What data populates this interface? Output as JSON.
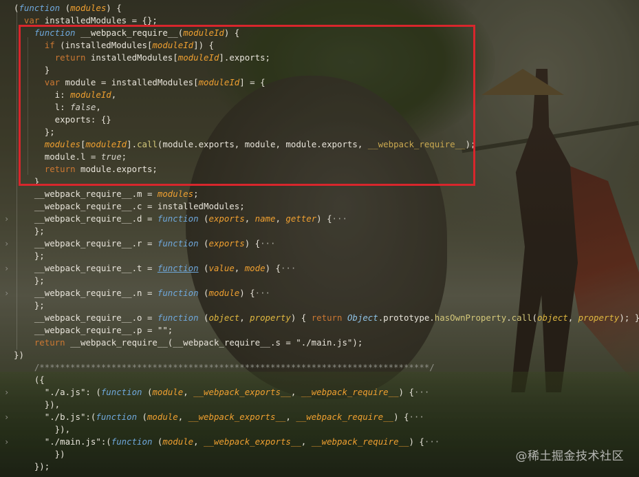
{
  "watermark": "@稀土掘金技术社区",
  "colors": {
    "highlight_border": "#d8262c",
    "keyword": "#cc7832",
    "function_keyword": "#6fa8dc",
    "param": "#f0a030"
  },
  "icons": {
    "fold_chevron": "chevron-right-icon"
  },
  "lines": [
    [
      [
        "(",
        "id"
      ],
      [
        "function",
        "kf"
      ],
      [
        " (",
        "id"
      ],
      [
        "modules",
        "p"
      ],
      [
        ") {",
        "id"
      ]
    ],
    [
      [
        "  "
      ],
      [
        "var",
        "k"
      ],
      [
        " installedModules = {};",
        "id"
      ]
    ],
    [
      [
        "    "
      ],
      [
        "function",
        "kf"
      ],
      [
        " __webpack_require__(",
        "id"
      ],
      [
        "moduleId",
        "p"
      ],
      [
        ") {",
        "id"
      ]
    ],
    [
      [
        "      "
      ],
      [
        "if",
        "k"
      ],
      [
        " (installedModules[",
        "id"
      ],
      [
        "moduleId",
        "p"
      ],
      [
        "]) {",
        "id"
      ]
    ],
    [
      [
        "        "
      ],
      [
        "return",
        "k"
      ],
      [
        " installedModules[",
        "id"
      ],
      [
        "moduleId",
        "p"
      ],
      [
        "].exports;",
        "id"
      ]
    ],
    [
      [
        "      }",
        "id"
      ]
    ],
    [
      [
        "      "
      ],
      [
        "var",
        "k"
      ],
      [
        " module = installedModules[",
        "id"
      ],
      [
        "moduleId",
        "p"
      ],
      [
        "] = {",
        "id"
      ]
    ],
    [
      [
        "        i: ",
        "id"
      ],
      [
        "moduleId",
        "p"
      ],
      [
        ",",
        "id"
      ]
    ],
    [
      [
        "        l: ",
        "id"
      ],
      [
        "false",
        "bool"
      ],
      [
        ",",
        "id"
      ]
    ],
    [
      [
        "        exports: {}",
        "id"
      ]
    ],
    [
      [
        "      };",
        "id"
      ]
    ],
    [
      [
        "      "
      ],
      [
        "modules",
        "p"
      ],
      [
        "[",
        "id"
      ],
      [
        "moduleId",
        "p"
      ],
      [
        "].",
        "id"
      ],
      [
        "call",
        "mth"
      ],
      [
        "(module.exports, module, module.exports, ",
        "id"
      ],
      [
        "__webpack_require__",
        "u"
      ],
      [
        ");",
        "id"
      ]
    ],
    [
      [
        "      module.l = ",
        "id"
      ],
      [
        "true",
        "bool"
      ],
      [
        ";",
        "id"
      ]
    ],
    [
      [
        "      "
      ],
      [
        "return",
        "k"
      ],
      [
        " module.exports;",
        "id"
      ]
    ],
    [
      [
        "    }",
        "id"
      ]
    ],
    [
      [
        "    __webpack_require__.m = ",
        "id"
      ],
      [
        "modules",
        "p"
      ],
      [
        ";",
        "id"
      ]
    ],
    [
      [
        "    __webpack_require__.c = installedModules;",
        "id"
      ]
    ],
    [
      [
        "    __webpack_require__.d = ",
        "id"
      ],
      [
        "function",
        "kf"
      ],
      [
        " (",
        "id"
      ],
      [
        "exports",
        "p"
      ],
      [
        ", ",
        "id"
      ],
      [
        "name",
        "p"
      ],
      [
        ", ",
        "id"
      ],
      [
        "getter",
        "p"
      ],
      [
        ") {",
        "id"
      ],
      [
        "···",
        "fold"
      ]
    ],
    [
      [
        "    };",
        "id"
      ]
    ],
    [
      [
        "    __webpack_require__.r = ",
        "id"
      ],
      [
        "function",
        "kf"
      ],
      [
        " (",
        "id"
      ],
      [
        "exports",
        "p"
      ],
      [
        ") {",
        "id"
      ],
      [
        "···",
        "fold"
      ]
    ],
    [
      [
        "    };",
        "id"
      ]
    ],
    [
      [
        "    __webpack_require__.t = ",
        "id"
      ],
      [
        "function",
        "kfu"
      ],
      [
        " (",
        "id"
      ],
      [
        "value",
        "p"
      ],
      [
        ", ",
        "id"
      ],
      [
        "mode",
        "p"
      ],
      [
        ") {",
        "id"
      ],
      [
        "···",
        "fold"
      ]
    ],
    [
      [
        "    };",
        "id"
      ]
    ],
    [
      [
        "    __webpack_require__.n = ",
        "id"
      ],
      [
        "function",
        "kf"
      ],
      [
        " (",
        "id"
      ],
      [
        "module",
        "p"
      ],
      [
        ") {",
        "id"
      ],
      [
        "···",
        "fold"
      ]
    ],
    [
      [
        "    };",
        "id"
      ]
    ],
    [
      [
        "    __webpack_require__.o = ",
        "id"
      ],
      [
        "function",
        "kf"
      ],
      [
        " (",
        "id"
      ],
      [
        "object",
        "pr"
      ],
      [
        ", ",
        "id"
      ],
      [
        "property",
        "pr"
      ],
      [
        ") { ",
        "id"
      ],
      [
        "return",
        "k"
      ],
      [
        " ",
        "id"
      ],
      [
        "Object",
        "obj"
      ],
      [
        ".prototype.",
        "id"
      ],
      [
        "hasOwnProperty",
        "mth"
      ],
      [
        ".",
        "id"
      ],
      [
        "call",
        "mth"
      ],
      [
        "(",
        "id"
      ],
      [
        "object",
        "pr"
      ],
      [
        ", ",
        "id"
      ],
      [
        "property",
        "pr"
      ],
      [
        "); };",
        "id"
      ]
    ],
    [
      [
        "    __webpack_require__.p = \"\";",
        "id"
      ]
    ],
    [
      [
        "    "
      ],
      [
        "return",
        "k"
      ],
      [
        " __webpack_require__(__webpack_require__.s = \"./main.js\");",
        "id"
      ]
    ],
    [
      [
        "})",
        "id"
      ]
    ],
    [
      [
        "    /****************************************************************************/",
        "cm"
      ]
    ],
    [
      [
        "    ({",
        "id"
      ]
    ],
    [
      [
        "      \"./a.js\": (",
        "id"
      ],
      [
        "function",
        "kf"
      ],
      [
        " (",
        "id"
      ],
      [
        "module",
        "p"
      ],
      [
        ", ",
        "id"
      ],
      [
        "__webpack_exports__",
        "p"
      ],
      [
        ", ",
        "id"
      ],
      [
        "__webpack_require__",
        "p"
      ],
      [
        ") {",
        "id"
      ],
      [
        "···",
        "fold"
      ]
    ],
    [
      [
        "      }),",
        "id"
      ]
    ],
    [
      [
        "      \"./b.js\":(",
        "id"
      ],
      [
        "function",
        "kf"
      ],
      [
        " (",
        "id"
      ],
      [
        "module",
        "p"
      ],
      [
        ", ",
        "id"
      ],
      [
        "__webpack_exports__",
        "p"
      ],
      [
        ", ",
        "id"
      ],
      [
        "__webpack_require__",
        "p"
      ],
      [
        ") {",
        "id"
      ],
      [
        "···",
        "fold"
      ]
    ],
    [
      [
        "        }),",
        "id"
      ]
    ],
    [
      [
        "      \"./main.js\":(",
        "id"
      ],
      [
        "function",
        "kf"
      ],
      [
        " (",
        "id"
      ],
      [
        "module",
        "p"
      ],
      [
        ", ",
        "id"
      ],
      [
        "__webpack_exports__",
        "p"
      ],
      [
        ", ",
        "id"
      ],
      [
        "__webpack_require__",
        "p"
      ],
      [
        ") {",
        "id"
      ],
      [
        "···",
        "fold"
      ]
    ],
    [
      [
        "        })",
        "id"
      ]
    ],
    [
      [
        "    });",
        "id"
      ]
    ]
  ],
  "folded_lines": [
    17,
    19,
    21,
    23,
    31,
    33,
    35
  ]
}
